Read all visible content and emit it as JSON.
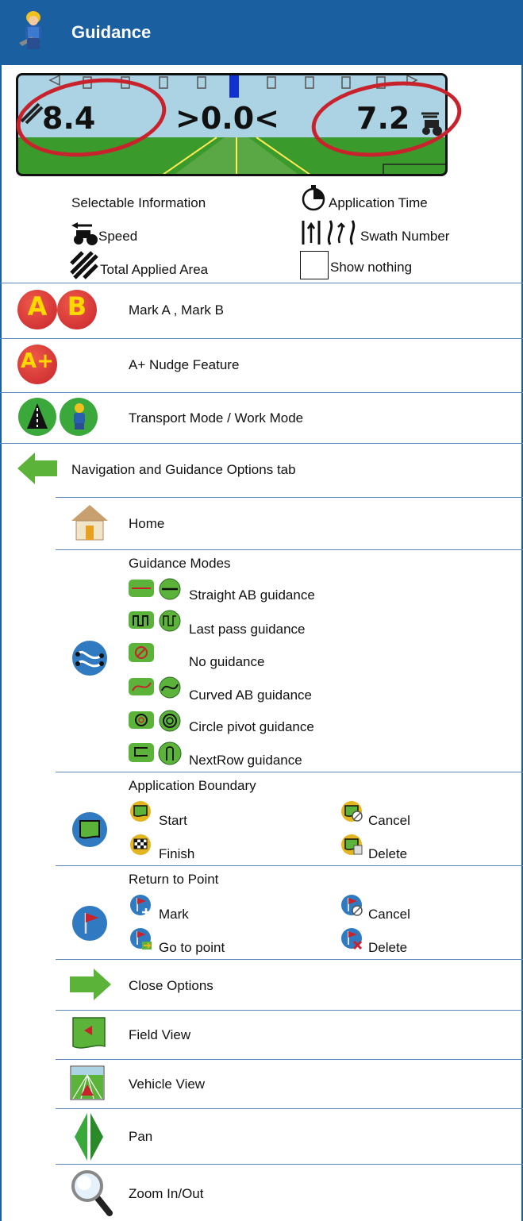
{
  "header": {
    "title": "Guidance"
  },
  "screen": {
    "left_value": "8.4",
    "center_value": ">0.0<",
    "right_value": "7.2"
  },
  "selectable": {
    "heading": "Selectable Information",
    "speed": "Speed",
    "total_applied_area": "Total Applied Area",
    "application_time": "Application Time",
    "swath_number": "Swath Number",
    "show_nothing": "Show nothing"
  },
  "rows": {
    "mark_ab": "Mark A , Mark B",
    "a_plus": "A+ Nudge Feature",
    "transport_work": "Transport Mode / Work Mode",
    "nav_options": "Navigation and Guidance Options tab",
    "home": "Home",
    "guidance_modes": {
      "title": "Guidance Modes",
      "items": [
        "Straight AB guidance",
        "Last pass guidance",
        "No guidance",
        "Curved AB guidance",
        "Circle pivot guidance",
        "NextRow guidance"
      ]
    },
    "boundary": {
      "title": "Application Boundary",
      "start": "Start",
      "finish": "Finish",
      "cancel": "Cancel",
      "delete": "Delete"
    },
    "return_point": {
      "title": "Return to Point",
      "mark": "Mark",
      "go_to_point": "Go to point",
      "cancel": "Cancel",
      "delete": "Delete"
    },
    "close_options": "Close Options",
    "field_view": "Field View",
    "vehicle_view": "Vehicle View",
    "pan": "Pan",
    "zoom": "Zoom In/Out"
  },
  "letters": {
    "a": "A",
    "b": "B",
    "a_plus": "A+"
  },
  "colors": {
    "header": "#1a5fa0",
    "separator": "#5b87b8",
    "highlight": "#c8232c",
    "accent_green": "#5cb33a",
    "accent_blue": "#2f7ac0",
    "accent_yellow": "#e3b520"
  }
}
